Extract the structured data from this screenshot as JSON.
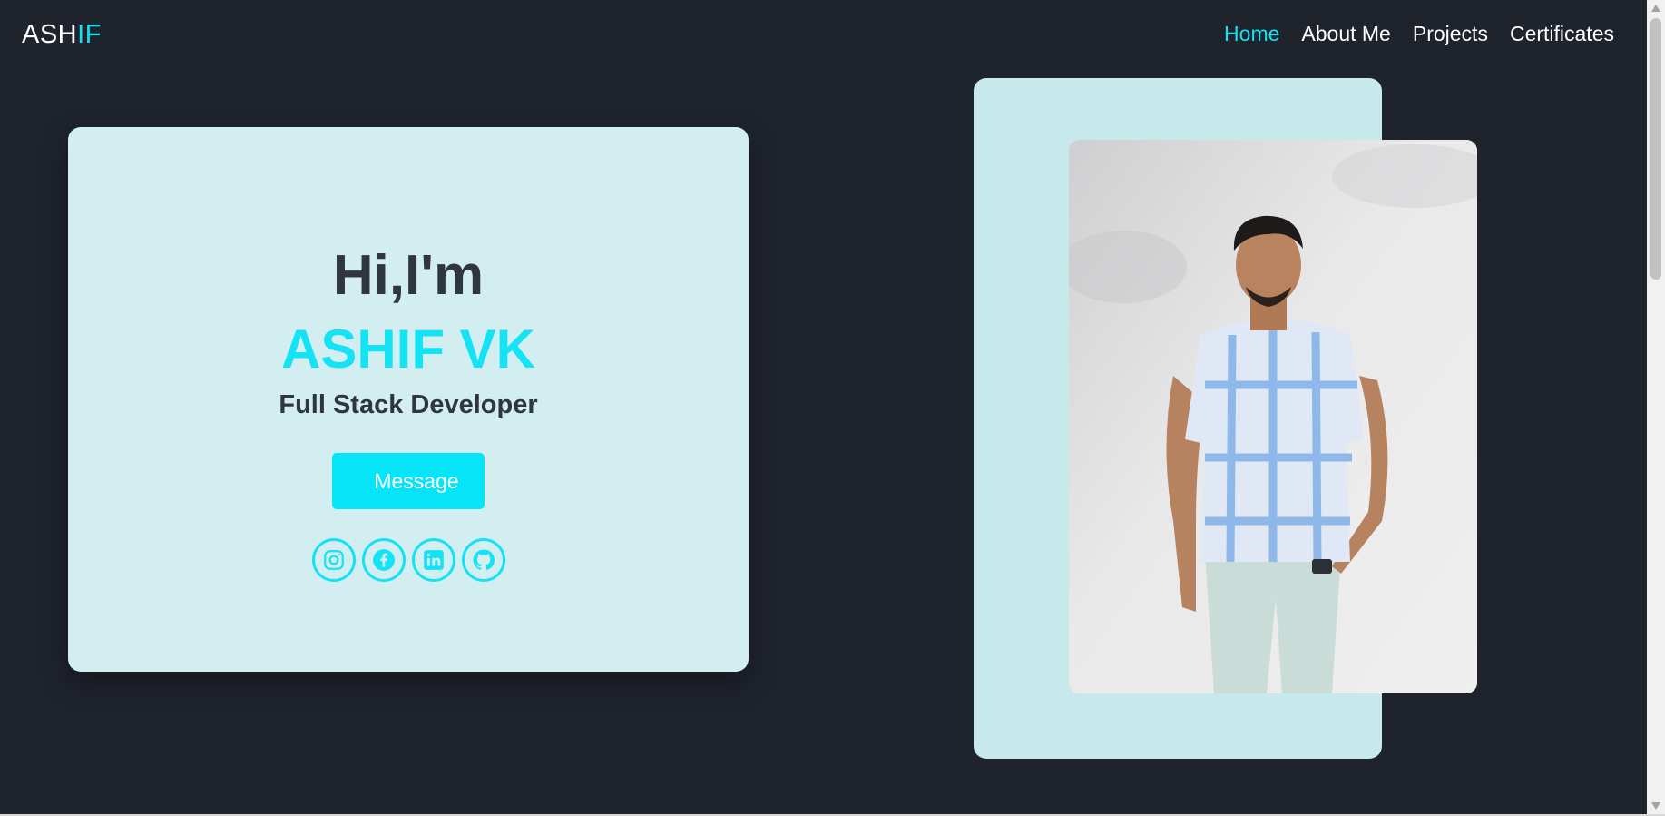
{
  "brand": {
    "part1": "ASH",
    "part2": "IF"
  },
  "nav": {
    "items": [
      {
        "label": "Home",
        "active": true
      },
      {
        "label": "About Me",
        "active": false
      },
      {
        "label": "Projects",
        "active": false
      },
      {
        "label": "Certificates",
        "active": false
      }
    ]
  },
  "hero": {
    "greeting": "Hi,I'm",
    "name": "ASHIF VK",
    "role": "Full Stack Developer",
    "button_label": "Message",
    "socials": [
      "instagram-icon",
      "facebook-icon",
      "linkedin-icon",
      "github-icon"
    ]
  },
  "colors": {
    "background": "#1f232c",
    "accent": "#14e2f5",
    "card": "#d3eef1",
    "text_dark": "#2f363f"
  }
}
